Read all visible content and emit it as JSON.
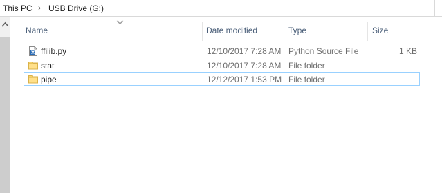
{
  "breadcrumb": {
    "items": [
      "This PC",
      "USB Drive (G:)"
    ],
    "separator": "›"
  },
  "columns": {
    "name": "Name",
    "date_modified": "Date modified",
    "type": "Type",
    "size": "Size"
  },
  "files": [
    {
      "name": "ffilib.py",
      "date": "12/10/2017 7:28 AM",
      "type": "Python Source File",
      "size": "1 KB",
      "icon": "python-file-icon"
    },
    {
      "name": "stat",
      "date": "12/10/2017 7:28 AM",
      "type": "File folder",
      "size": "",
      "icon": "folder-icon"
    },
    {
      "name": "pipe",
      "date": "12/12/2017 1:53 PM",
      "type": "File folder",
      "size": "",
      "icon": "folder-icon"
    }
  ],
  "colors": {
    "header_text": "#4c607a",
    "selection_outline": "#99d1ff",
    "folder": "#f6d36b",
    "python_blue": "#2a6cb5"
  }
}
